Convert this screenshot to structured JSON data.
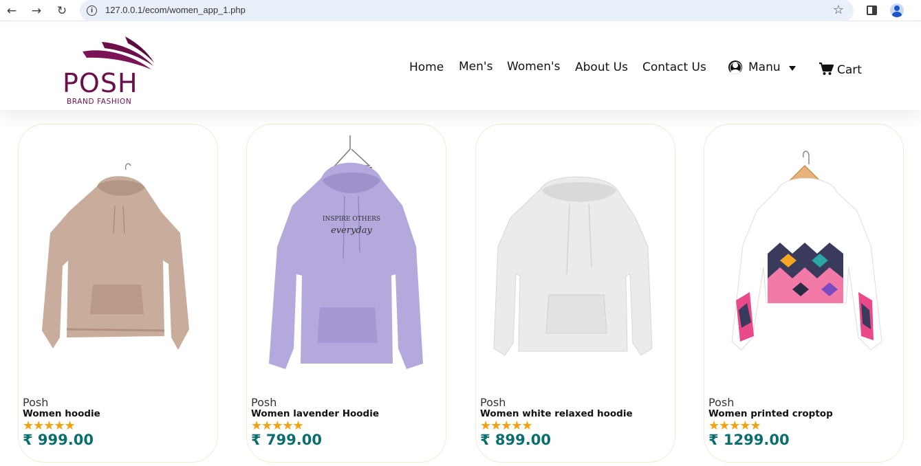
{
  "browser": {
    "url": "127.0.0.1/ecom/women_app_1.php",
    "back_icon": "back-arrow-icon",
    "forward_icon": "forward-arrow-icon",
    "reload_icon": "reload-icon"
  },
  "header": {
    "logo_text": "POSH",
    "logo_subtext": "BRAND FASHION",
    "brand_color": "#6b0f4a",
    "nav": [
      {
        "label": "Home"
      },
      {
        "label": "Men's"
      },
      {
        "label": "Women's"
      },
      {
        "label": "About Us"
      },
      {
        "label": "Contact Us"
      }
    ],
    "account_label": "Manu",
    "cart_label": "Cart"
  },
  "products": [
    {
      "brand": "Posh",
      "name": "Women hoodie",
      "rating": 5,
      "stars": "★★★★★",
      "price": "₹ 999.00",
      "color": "#c9ad9b"
    },
    {
      "brand": "Posh",
      "name": "Women lavender Hoodie",
      "rating": 5,
      "stars": "★★★★★",
      "price": "₹ 799.00",
      "color": "#b3a8dc"
    },
    {
      "brand": "Posh",
      "name": "Women white relaxed hoodie",
      "rating": 5,
      "stars": "★★★★★",
      "price": "₹ 899.00",
      "color": "#eeeeee"
    },
    {
      "brand": "Posh",
      "name": "Women printed croptop",
      "rating": 5,
      "stars": "★★★★★",
      "price": "₹ 1299.00",
      "color": "#ffffff"
    }
  ],
  "lavender_print": [
    "INSPIRE OTHERS",
    "everyday"
  ],
  "colors": {
    "price": "#0b6e6e",
    "star": "#f5a00d",
    "card_border": "#ecefd0"
  }
}
